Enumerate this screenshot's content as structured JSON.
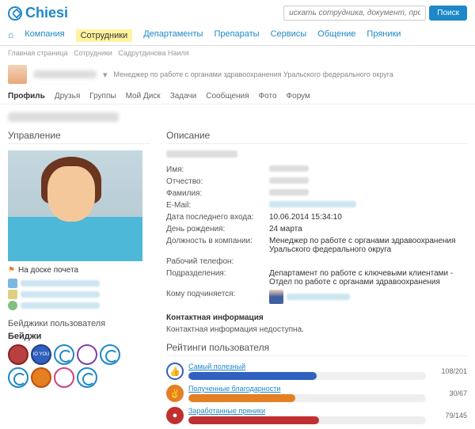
{
  "logo": "Chiesi",
  "search": {
    "placeholder": "искать сотрудника, документ, прочее...",
    "button": "Поиск"
  },
  "nav": [
    "Компания",
    "Сотрудники",
    "Департаменты",
    "Препараты",
    "Сервисы",
    "Общение",
    "Пряники"
  ],
  "breadcrumb": [
    "Главная страница",
    "Сотрудники",
    "Садрутдинова Наиля"
  ],
  "role": "Менеджер по работе с органами здравоохранения Уральского федерального округа",
  "tabs": [
    "Профиль",
    "Друзья",
    "Группы",
    "Мой Диск",
    "Задачи",
    "Сообщения",
    "Фото",
    "Форум"
  ],
  "left": {
    "heading": "Управление",
    "honor": "На доске почета",
    "badges_heading": "Бейджики пользователя",
    "badges_sub": "Бейджи"
  },
  "desc": {
    "heading": "Описание",
    "labels": {
      "name": "Имя:",
      "patronymic": "Отчество:",
      "surname": "Фамилия:",
      "email": "E-Mail:",
      "lastlogin": "Дата последнего входа:",
      "birthday": "День рождения:",
      "position": "Должность в компании:",
      "workphone": "Рабочий телефон:",
      "departments": "Подразделения:",
      "supervisor": "Кому подчиняется:"
    },
    "values": {
      "lastlogin": "10.06.2014 15:34:10",
      "birthday": "24 марта",
      "position": "Менеджер по работе с органами здравоохранения Уральского федерального округа",
      "dept1": "Департамент по работе с ключевыми клиентами",
      "dept_sep": " - ",
      "dept2": "Отдел по работе с органами здравоохранения"
    },
    "contact_h": "Контактная информация",
    "contact_text": "Контактная информация недоступна."
  },
  "ratings": {
    "heading": "Рейтинги пользователя",
    "items": [
      {
        "label": "Самый полезный",
        "value": "108/201"
      },
      {
        "label": "Полученные благодарности",
        "value": "30/67"
      },
      {
        "label": "Заработанные пряники",
        "value": "79/145"
      }
    ]
  }
}
